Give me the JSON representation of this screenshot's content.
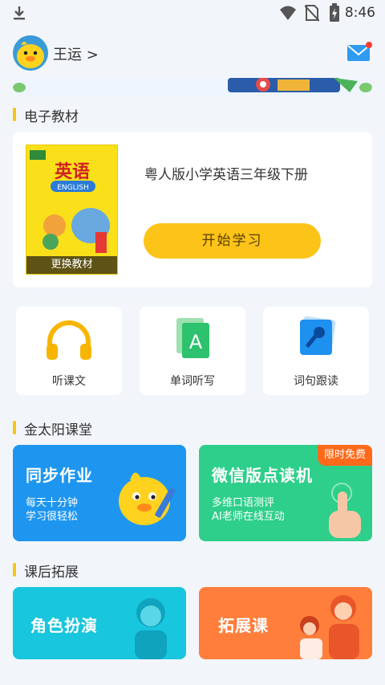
{
  "status_bar": {
    "time": "8:46",
    "icons": [
      "download-icon",
      "wifi-icon",
      "no-sim-icon",
      "battery-charging-icon"
    ]
  },
  "header": {
    "user_name": "王运 >",
    "mail_icon": "mail-icon",
    "has_notification": true
  },
  "textbook_section": {
    "title": "电子教材",
    "book_title": "粤人版小学英语三年级下册",
    "cover_title": "英语",
    "cover_subtitle": "ENGLISH",
    "change_label": "更换教材",
    "start_label": "开始学习"
  },
  "tools": [
    {
      "label": "听课文",
      "icon": "headphones-icon"
    },
    {
      "label": "单词听写",
      "icon": "letter-card-icon"
    },
    {
      "label": "词句跟读",
      "icon": "microphone-icon"
    }
  ],
  "classroom_section": {
    "title": "金太阳课堂",
    "cards": [
      {
        "title": "同步作业",
        "sub1": "每天十分钟",
        "sub2": "学习很轻松"
      },
      {
        "title": "微信版点读机",
        "sub1": "多维口语测评",
        "sub2": "AI老师在线互动",
        "badge": "限时免费"
      }
    ]
  },
  "extension_section": {
    "title": "课后拓展",
    "cards": [
      {
        "title": "角色扮演"
      },
      {
        "title": "拓展课"
      }
    ]
  },
  "colors": {
    "accent_yellow": "#fcc419",
    "blue_card": "#1e96f0",
    "green_card": "#2ecf8a",
    "cyan_card": "#18c6dd",
    "orange_card": "#ff7e3c",
    "badge": "#ff6a1a"
  }
}
